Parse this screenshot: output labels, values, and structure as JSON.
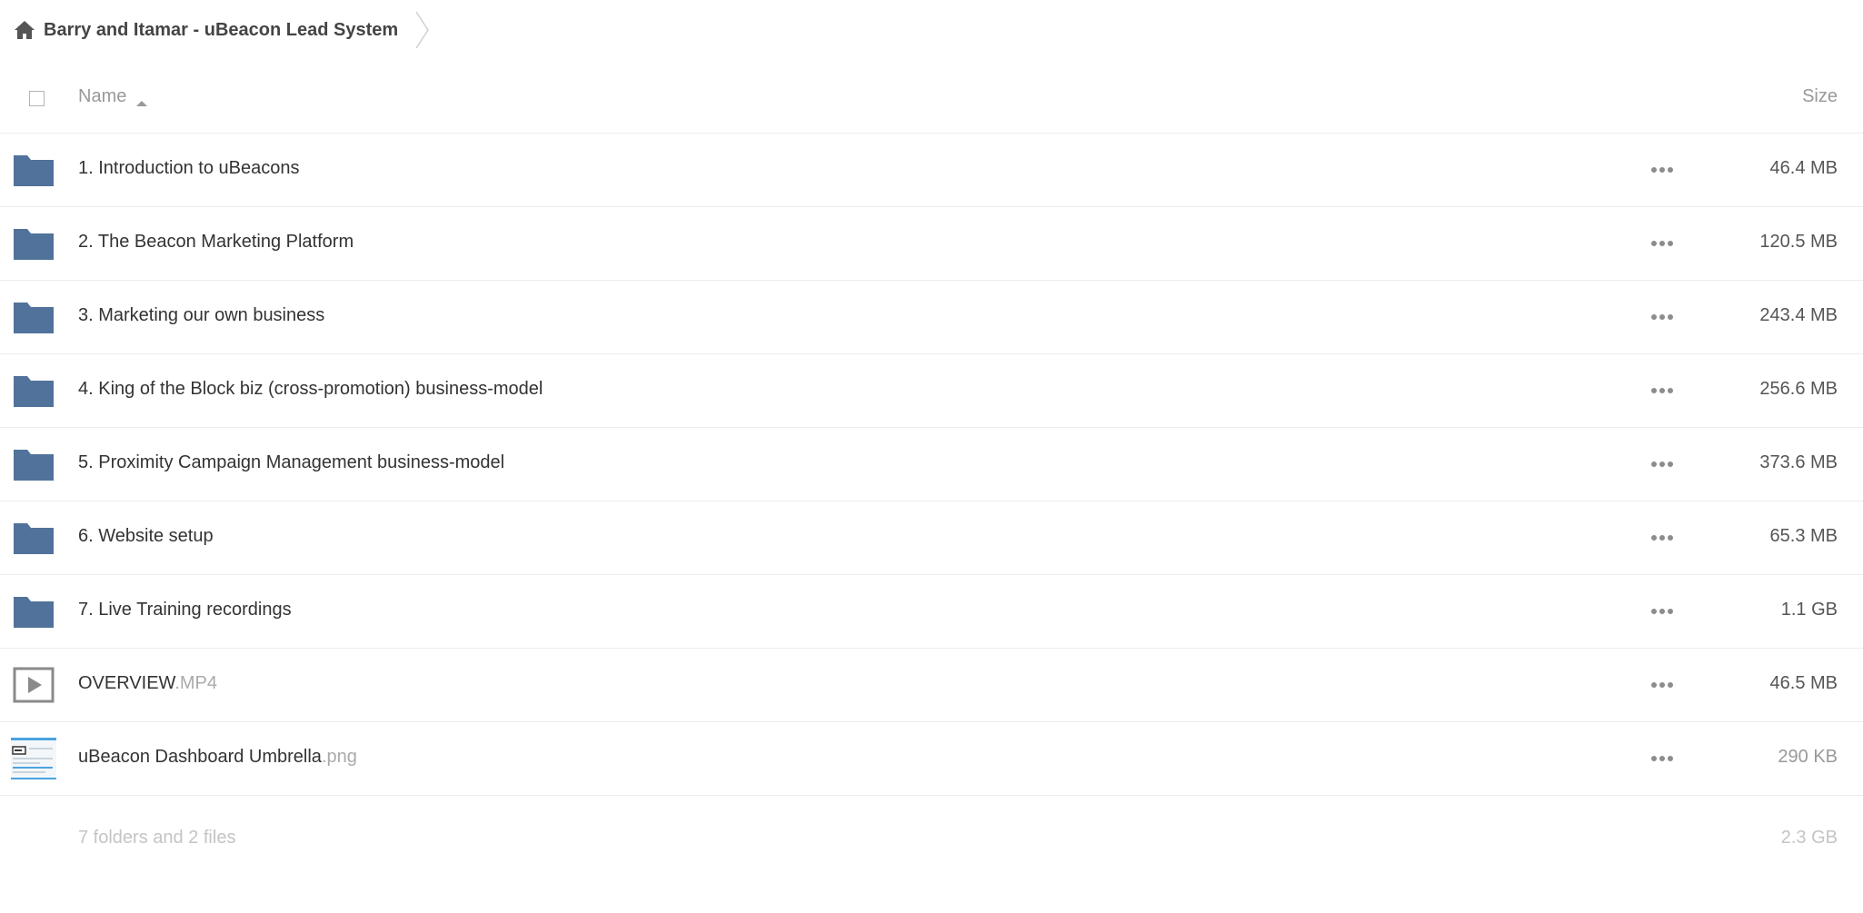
{
  "breadcrumb": {
    "home_icon": "home-icon",
    "title": "Barry and Itamar - uBeacon Lead System"
  },
  "table": {
    "columns": {
      "name": "Name",
      "size": "Size"
    },
    "sort_icon": "caret-up-icon",
    "rows": [
      {
        "icon": "folder-icon",
        "name": "1. Introduction to uBeacons",
        "ext": "",
        "size": "46.4 MB"
      },
      {
        "icon": "folder-icon",
        "name": "2. The Beacon Marketing Platform",
        "ext": "",
        "size": "120.5 MB"
      },
      {
        "icon": "folder-icon",
        "name": "3. Marketing our own business",
        "ext": "",
        "size": "243.4 MB"
      },
      {
        "icon": "folder-icon",
        "name": "4. King of the Block biz (cross-promotion) business-model",
        "ext": "",
        "size": "256.6 MB"
      },
      {
        "icon": "folder-icon",
        "name": "5. Proximity Campaign Management business-model",
        "ext": "",
        "size": "373.6 MB"
      },
      {
        "icon": "folder-icon",
        "name": "6. Website setup",
        "ext": "",
        "size": "65.3 MB"
      },
      {
        "icon": "folder-icon",
        "name": "7. Live Training recordings",
        "ext": "",
        "size": "1.1 GB"
      },
      {
        "icon": "video-icon",
        "name": "OVERVIEW",
        "ext": ".MP4",
        "size": "46.5 MB"
      },
      {
        "icon": "image-thumbnail",
        "name": "uBeacon Dashboard Umbrella",
        "ext": ".png",
        "size": "290 KB"
      }
    ],
    "summary": "7 folders and 2 files",
    "total": "2.3 GB"
  },
  "colors": {
    "folder": "#51729b",
    "text": "#333333",
    "muted": "#999999",
    "divider": "#ececec"
  }
}
